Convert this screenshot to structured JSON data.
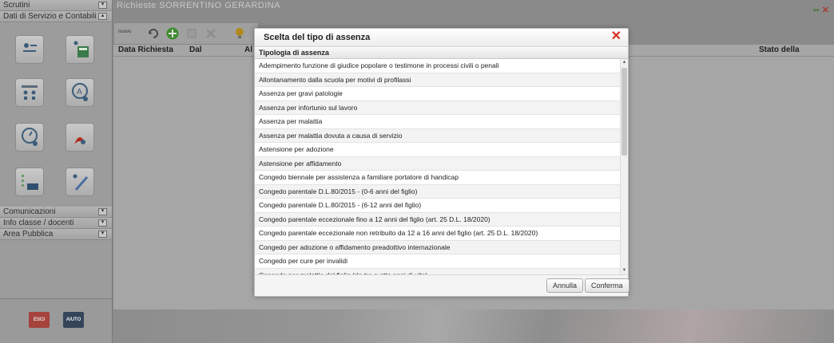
{
  "sidebar": {
    "sections": [
      {
        "label": "Scrutini"
      },
      {
        "label": "Dati di Servizio e Contabili"
      }
    ],
    "menus": [
      {
        "label": "Comunicazioni"
      },
      {
        "label": "Info classe / docenti"
      },
      {
        "label": "Area Pubblica"
      }
    ],
    "bottom_badges": [
      {
        "label": "ESCI"
      },
      {
        "label": "AIUTO"
      }
    ]
  },
  "main": {
    "title": "Richieste SORRENTINO GERARDINA",
    "toolbar_label": "nuovo",
    "columns": [
      "Data Richiesta",
      "Dal",
      "Al",
      "Stato della richiesta"
    ]
  },
  "dialog": {
    "title": "Scelta del tipo di assenza",
    "column_header": "Tipologia di assenza",
    "items": [
      "Adempimento funzione di giudice popolare o testimone in processi civili o penali",
      "Allontanamento dalla scuola per motivi di profilassi",
      "Assenza per gravi patologie",
      "Assenza per infortunio sul lavoro",
      "Assenza per malattia",
      "Assenza per malattia dovuta a causa di servizio",
      "Astensione per adozione",
      "Astensione per affidamento",
      "Congedo biennale per assistenza a familiare portatore di handicap",
      "Congedo parentale D.L.80/2015 - (0-6 anni del figlio)",
      "Congedo parentale D.L.80/2015 - (6-12 anni del figlio)",
      "Congedo parentale eccezionale fino a 12 anni del figlio (art. 25 D.L. 18/2020)",
      "Congedo parentale eccezionale non retribuito da 12 a 16 anni del figlio (art. 25 D.L. 18/2020)",
      "Congedo per adozione o affidamento preadottivo internazionale",
      "Congedo per cure per invalidi",
      "Congedo per malattia del figlio (da tre a otto anni di vita)"
    ],
    "cancel_label": "Annulla",
    "confirm_label": "Conferma"
  },
  "colors": {
    "close_red": "#d62d20",
    "overlay_gray": "#8a8a8a"
  },
  "icons": [
    "close-icon",
    "refresh-icon",
    "add-icon",
    "delete-icon",
    "lightbulb-icon"
  ]
}
